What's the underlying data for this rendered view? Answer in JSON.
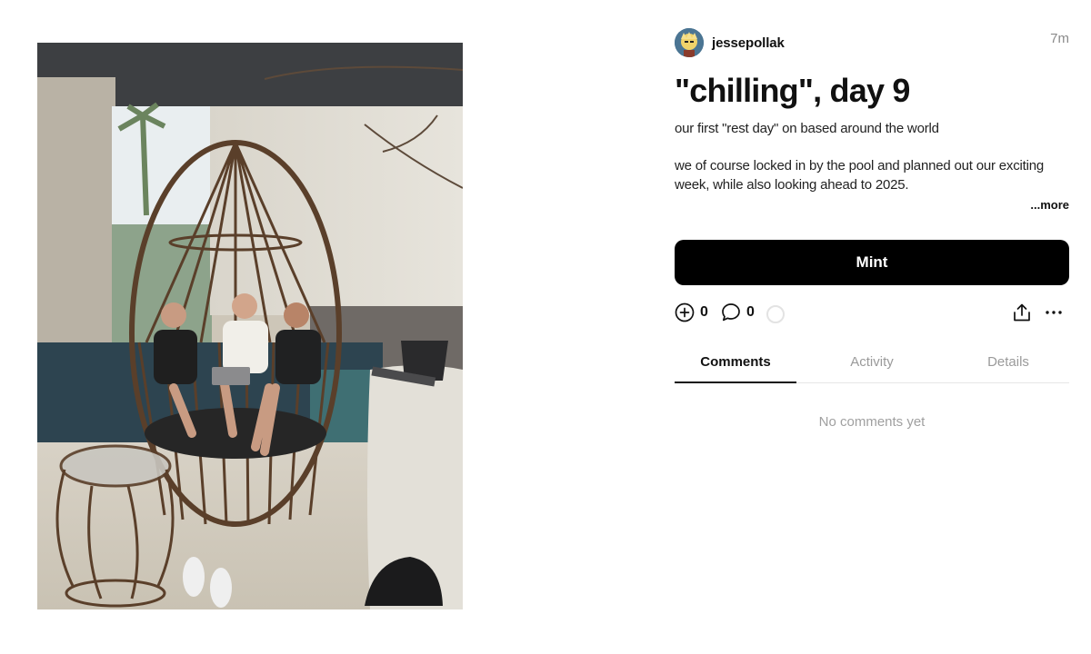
{
  "post": {
    "author": "jessepollak",
    "time_ago": "7m",
    "title": "\"chilling\", day 9",
    "body": [
      "our first \"rest day\" on based around the world",
      "we of course locked in by the pool and planned out our exciting week, while also looking ahead to 2025."
    ],
    "more_label": "...more",
    "image_alt": "Three people relaxing in a large wicker egg-shaped chair by a pool"
  },
  "mint": {
    "label": "Mint"
  },
  "actions": {
    "collect_count": "0",
    "comment_count": "0",
    "icons": [
      "plus-circle-icon",
      "comment-icon",
      "loading-ring",
      "share-icon",
      "more-horizontal-icon"
    ]
  },
  "tabs": [
    {
      "label": "Comments",
      "active": true
    },
    {
      "label": "Activity",
      "active": false
    },
    {
      "label": "Details",
      "active": false
    }
  ],
  "comments": {
    "empty_text": "No comments yet"
  },
  "colors": {
    "primary": "#000000",
    "muted": "#9a9a9a",
    "divider": "#e6e6e6"
  }
}
